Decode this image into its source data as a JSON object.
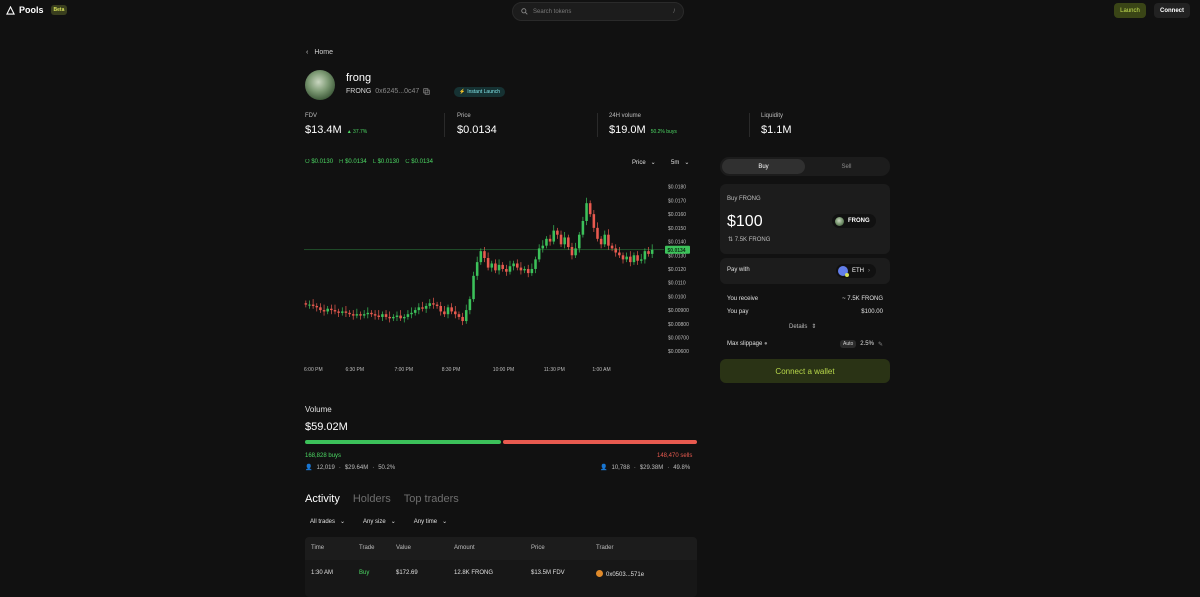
{
  "topbar": {
    "brand": "Pools",
    "beta": "Beta",
    "search_placeholder": "Search tokens",
    "search_shortcut": "/",
    "launch_label": "Launch",
    "connect_label": "Connect"
  },
  "breadcrumb": {
    "back_label": "Home"
  },
  "token": {
    "name": "frong",
    "symbol": "FRONG",
    "address": "0x6245...0c47",
    "badge": "Instant Launch"
  },
  "stats": {
    "fdv_label": "FDV",
    "fdv_value": "$13.4M",
    "fdv_change": "▲ 37.7%",
    "price_label": "Price",
    "price_value": "$0.0134",
    "volume_label": "24H volume",
    "volume_value": "$19.0M",
    "volume_buys": "50.2% buys",
    "liquidity_label": "Liquidity",
    "liquidity_value": "$1.1M"
  },
  "ohlc": {
    "o_key": "O",
    "o_val": "$0.0130",
    "h_key": "H",
    "h_val": "$0.0134",
    "l_key": "L",
    "l_val": "$0.0130",
    "c_key": "C",
    "c_val": "$0.0134"
  },
  "chart_controls": {
    "mode": "Price",
    "interval": "5m"
  },
  "chart_data": {
    "type": "candlestick",
    "y_ticks": [
      "$0.0180",
      "$0.0170",
      "$0.0160",
      "$0.0150",
      "$0.0140",
      "$0.0130",
      "$0.0120",
      "$0.0110",
      "$0.0100",
      "$0.00900",
      "$0.00800",
      "$0.00700",
      "$0.00600"
    ],
    "y_tick_values": [
      0.018,
      0.017,
      0.016,
      0.015,
      0.014,
      0.013,
      0.012,
      0.011,
      0.01,
      0.009,
      0.008,
      0.007,
      0.006
    ],
    "ylim": [
      0.00565,
      0.0182
    ],
    "x_ticks": [
      "6:00 PM",
      "6:30 PM",
      "7:00 PM",
      "8:30 PM",
      "10:00 PM",
      "11:30 PM",
      "1:00 AM"
    ],
    "x_tick_positions": [
      0,
      14.5,
      28.5,
      42,
      57,
      71.5,
      85
    ],
    "current_price_label": "$0.0134",
    "current_price": 0.0134,
    "closes": [
      0.0094,
      0.0094,
      0.0093,
      0.0092,
      0.009,
      0.0089,
      0.0091,
      0.009,
      0.0089,
      0.0088,
      0.0089,
      0.0088,
      0.0087,
      0.0086,
      0.0087,
      0.0086,
      0.0087,
      0.0088,
      0.0087,
      0.0086,
      0.0085,
      0.0087,
      0.0085,
      0.0084,
      0.0085,
      0.0086,
      0.0084,
      0.0085,
      0.0087,
      0.0088,
      0.009,
      0.0092,
      0.0091,
      0.0093,
      0.0095,
      0.0094,
      0.0093,
      0.0089,
      0.0087,
      0.0092,
      0.0089,
      0.0087,
      0.0085,
      0.0082,
      0.009,
      0.0098,
      0.0115,
      0.0125,
      0.0133,
      0.0128,
      0.0121,
      0.0124,
      0.0119,
      0.0123,
      0.012,
      0.0118,
      0.0122,
      0.0124,
      0.0121,
      0.0119,
      0.012,
      0.0117,
      0.012,
      0.0127,
      0.0135,
      0.0137,
      0.0142,
      0.014,
      0.0148,
      0.0145,
      0.0138,
      0.0143,
      0.0136,
      0.013,
      0.0135,
      0.0145,
      0.0155,
      0.0168,
      0.016,
      0.015,
      0.0142,
      0.0138,
      0.0145,
      0.0137,
      0.0135,
      0.0132,
      0.013,
      0.0127,
      0.0129,
      0.0125,
      0.013,
      0.0126,
      0.0127,
      0.0133,
      0.0131,
      0.0134
    ],
    "open_first": 0.0095
  },
  "volume": {
    "label": "Volume",
    "total": "$59.02M",
    "buy_share": 50.2,
    "buys": "168,828 buys",
    "sells": "148,470 sells",
    "buyers": "12,019",
    "buy_value": "$29.64M",
    "buy_pct": "50.2%",
    "sellers": "10,788",
    "sell_value": "$29.38M",
    "sell_pct": "49.8%"
  },
  "tabs": [
    "Activity",
    "Holders",
    "Top traders"
  ],
  "filters": [
    "All trades",
    "Any size",
    "Any time"
  ],
  "table": {
    "headers": [
      "Time",
      "Trade",
      "Value",
      "Amount",
      "Price",
      "Trader"
    ],
    "rows": [
      {
        "time": "1:30 AM",
        "trade": "Buy",
        "value": "$172.69",
        "amount": "12.8K FRONG",
        "price": "$13.5M FDV",
        "trader": "0x0503...571e"
      }
    ]
  },
  "trade_panel": {
    "buy_tab": "Buy",
    "sell_tab": "Sell",
    "buy_title": "Buy FRONG",
    "amount": "$100",
    "token_chip": "FRONG",
    "converted": "7.5K FRONG",
    "pay_with_label": "Pay with",
    "pay_token": "ETH",
    "receive_label": "You receive",
    "receive_value": "~ 7.5K FRONG",
    "pay_label": "You pay",
    "pay_value": "$100.00",
    "details_label": "Details",
    "slippage_label": "Max slippage",
    "slippage_mode": "Auto",
    "slippage_value": "2.5%",
    "connect_wallet": "Connect a wallet"
  },
  "colors": {
    "up": "#3cc15a",
    "down": "#e85a4f",
    "accent": "#c6e352",
    "background": "#111111"
  }
}
